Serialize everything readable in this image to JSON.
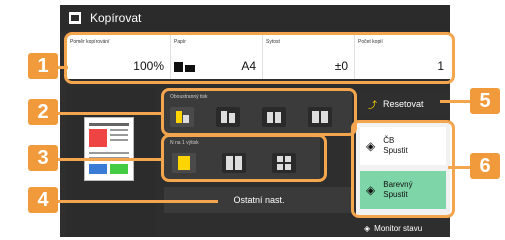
{
  "title": "Kopírovat",
  "info": {
    "ratio_label": "Poměr kopírování",
    "ratio_value": "100%",
    "paper_label": "Papír",
    "paper_value": "A4",
    "density_label": "Sytost",
    "density_value": "±0",
    "copies_label": "Počet kopií",
    "copies_value": "1"
  },
  "duplex_label": "Oboustranný tisk",
  "layout_label": "N na 1 výtisk",
  "other_settings": "Ostatní nast.",
  "reset": "Resetovat",
  "start_bw": {
    "line1": "ČB",
    "line2": "Spustit"
  },
  "start_color": {
    "line1": "Barevný",
    "line2": "Spustit"
  },
  "monitor": "Monitor stavu",
  "callouts": [
    "1",
    "2",
    "3",
    "4",
    "5",
    "6"
  ],
  "colors": {
    "accent": "#f19a3b",
    "highlight": "#ffd500",
    "color_button": "#7ed6a8"
  }
}
